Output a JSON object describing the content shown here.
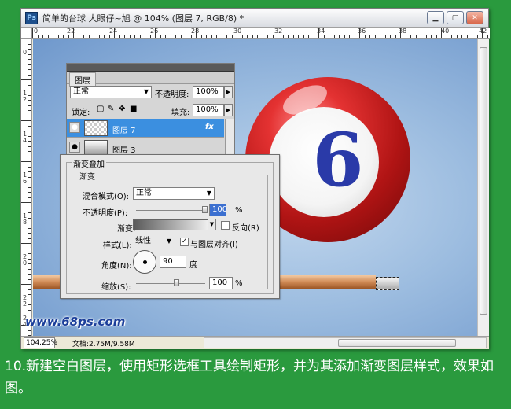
{
  "window": {
    "app_icon": "Ps",
    "title": "简单的台球  大眼仔~旭 @ 104% (图层 7, RGB/8) *",
    "btn_min": "▁",
    "btn_max": "▢",
    "btn_close": "✕"
  },
  "ruler": {
    "top_labels": [
      "0",
      "22",
      "24",
      "26",
      "28",
      "30",
      "32",
      "34",
      "36",
      "38",
      "40",
      "42"
    ],
    "left_labels": [
      "0",
      "12",
      "14",
      "16",
      "18",
      "20",
      "22",
      "24"
    ]
  },
  "layers_panel": {
    "tab": "图层",
    "blend_mode": "正常",
    "opacity_label": "不透明度:",
    "opacity_value": "100%",
    "lock_label": "锁定:",
    "fill_label": "填充:",
    "fill_value": "100%",
    "layers": [
      {
        "name": "图层 7",
        "fx": "fx",
        "selected": true
      },
      {
        "name": "图层 3",
        "fx": "",
        "selected": false
      }
    ]
  },
  "gradient_dialog": {
    "section_title": "渐变叠加",
    "group_title": "渐变",
    "blend_mode_label": "混合模式(O):",
    "blend_mode_value": "正常",
    "opacity_label": "不透明度(P):",
    "opacity_value": "100",
    "opacity_unit": "%",
    "gradient_label": "渐变:",
    "reverse_label": "反向(R)",
    "reverse_checked": false,
    "style_label": "样式(L):",
    "style_value": "线性",
    "align_label": "与图层对齐(I)",
    "align_checked": true,
    "check_mark": "✓",
    "angle_label": "角度(N):",
    "angle_value": "90",
    "angle_unit": "度",
    "scale_label": "缩放(S):",
    "scale_value": "100",
    "scale_unit": "%"
  },
  "status": {
    "zoom": "104.25%",
    "doc_info": "文档:2.75M/9.58M"
  },
  "canvas": {
    "ball_number": "6",
    "watermark": "www.68ps.com"
  },
  "caption": "10.新建空白图层，使用矩形选框工具绘制矩形，并为其添加渐变图层样式，效果如图。",
  "colors": {
    "background": "#2a9a3e",
    "selected_layer": "#3b8fe0",
    "ball_red": "#c81c1c",
    "number_blue": "#2a3aa8"
  }
}
